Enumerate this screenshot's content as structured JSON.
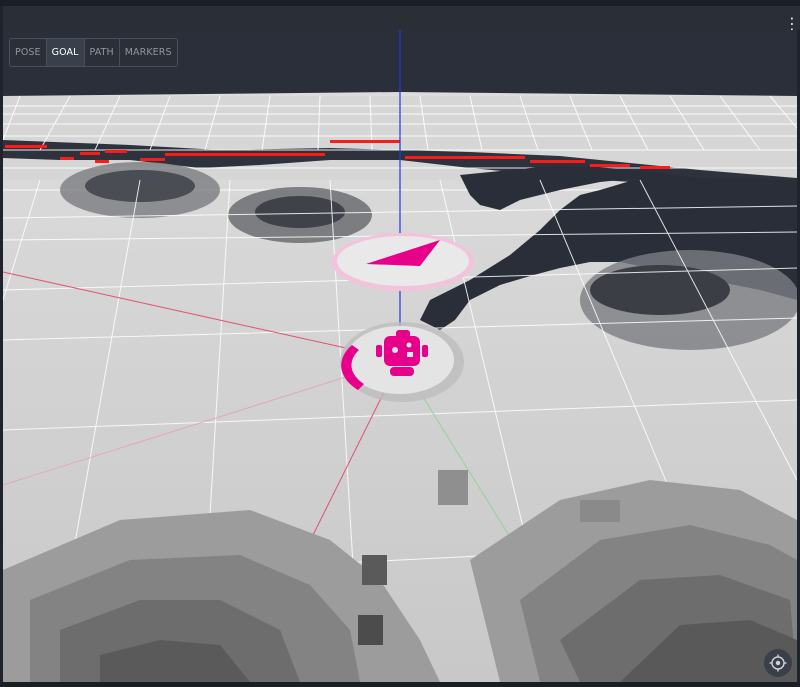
{
  "panel": {
    "menu_label": "⋮"
  },
  "toolbar": {
    "tabs": [
      {
        "label": "POSE",
        "active": false
      },
      {
        "label": "GOAL",
        "active": true
      },
      {
        "label": "PATH",
        "active": false
      },
      {
        "label": "MARKERS",
        "active": false
      }
    ]
  },
  "scene": {
    "robot_icon": "robot-icon",
    "goal_icon": "goal-arrow-icon",
    "recenter_icon": "crosshair-icon",
    "accent_color": "#e6008a",
    "obstacle_color": "#ff1a1a",
    "grid_color": "#ffffff",
    "floor_color": "#c9c9c9",
    "unknown_color": "#2a2e38"
  }
}
